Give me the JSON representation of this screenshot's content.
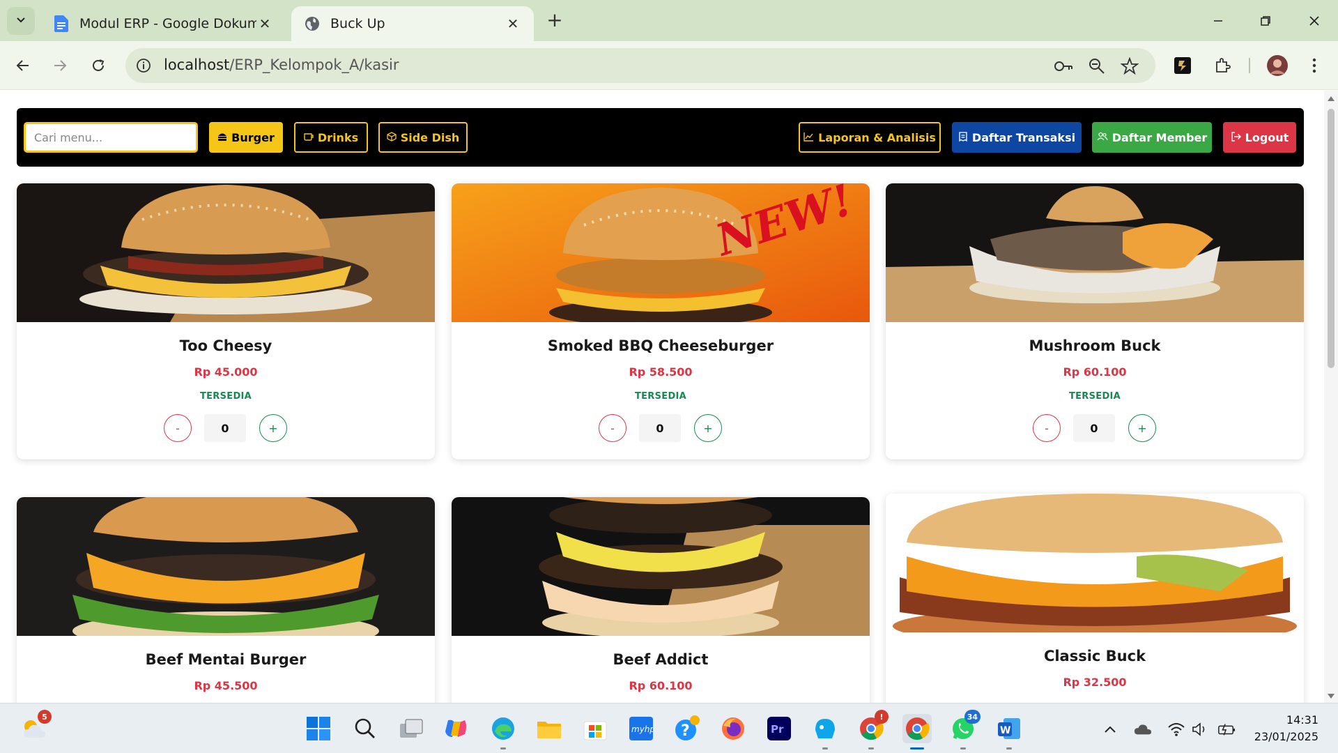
{
  "browser": {
    "tabs": [
      {
        "title": "Modul ERP - Google Dokumen",
        "icon": "google-docs-icon",
        "active": false
      },
      {
        "title": "Buck Up",
        "icon": "globe-icon",
        "active": true
      }
    ],
    "url_host": "localhost",
    "url_path": "/ERP_Kelompok_A/kasir"
  },
  "navbar": {
    "search_placeholder": "Cari menu...",
    "burger": "Burger",
    "drinks": "Drinks",
    "side_dish": "Side Dish",
    "laporan": "Laporan & Analisis",
    "transaksi": "Daftar Transaksi",
    "member": "Daftar Member",
    "logout": "Logout",
    "colors": {
      "accent": "#f5c518",
      "transaksi": "#0d47a1",
      "member": "#3aa845",
      "logout": "#dc3545"
    }
  },
  "menu": [
    {
      "name": "Too Cheesy",
      "price": "Rp 45.000",
      "status": "TERSEDIA",
      "qty": "0",
      "minus": "-",
      "plus": "+"
    },
    {
      "name": "Smoked BBQ Cheeseburger",
      "price": "Rp 58.500",
      "status": "TERSEDIA",
      "qty": "0",
      "minus": "-",
      "plus": "+",
      "banner": "NEW!"
    },
    {
      "name": "Mushroom Buck",
      "price": "Rp 60.100",
      "status": "TERSEDIA",
      "qty": "0",
      "minus": "-",
      "plus": "+"
    },
    {
      "name": "Beef Mentai Burger",
      "price": "Rp 45.500"
    },
    {
      "name": "Beef Addict",
      "price": "Rp 60.100"
    },
    {
      "name": "Classic Buck",
      "price": "Rp 32.500"
    }
  ],
  "taskbar": {
    "weather_badge": "5",
    "chrome_badge": "!",
    "whatsapp_badge": "34",
    "time": "14:31",
    "date": "23/01/2025"
  }
}
